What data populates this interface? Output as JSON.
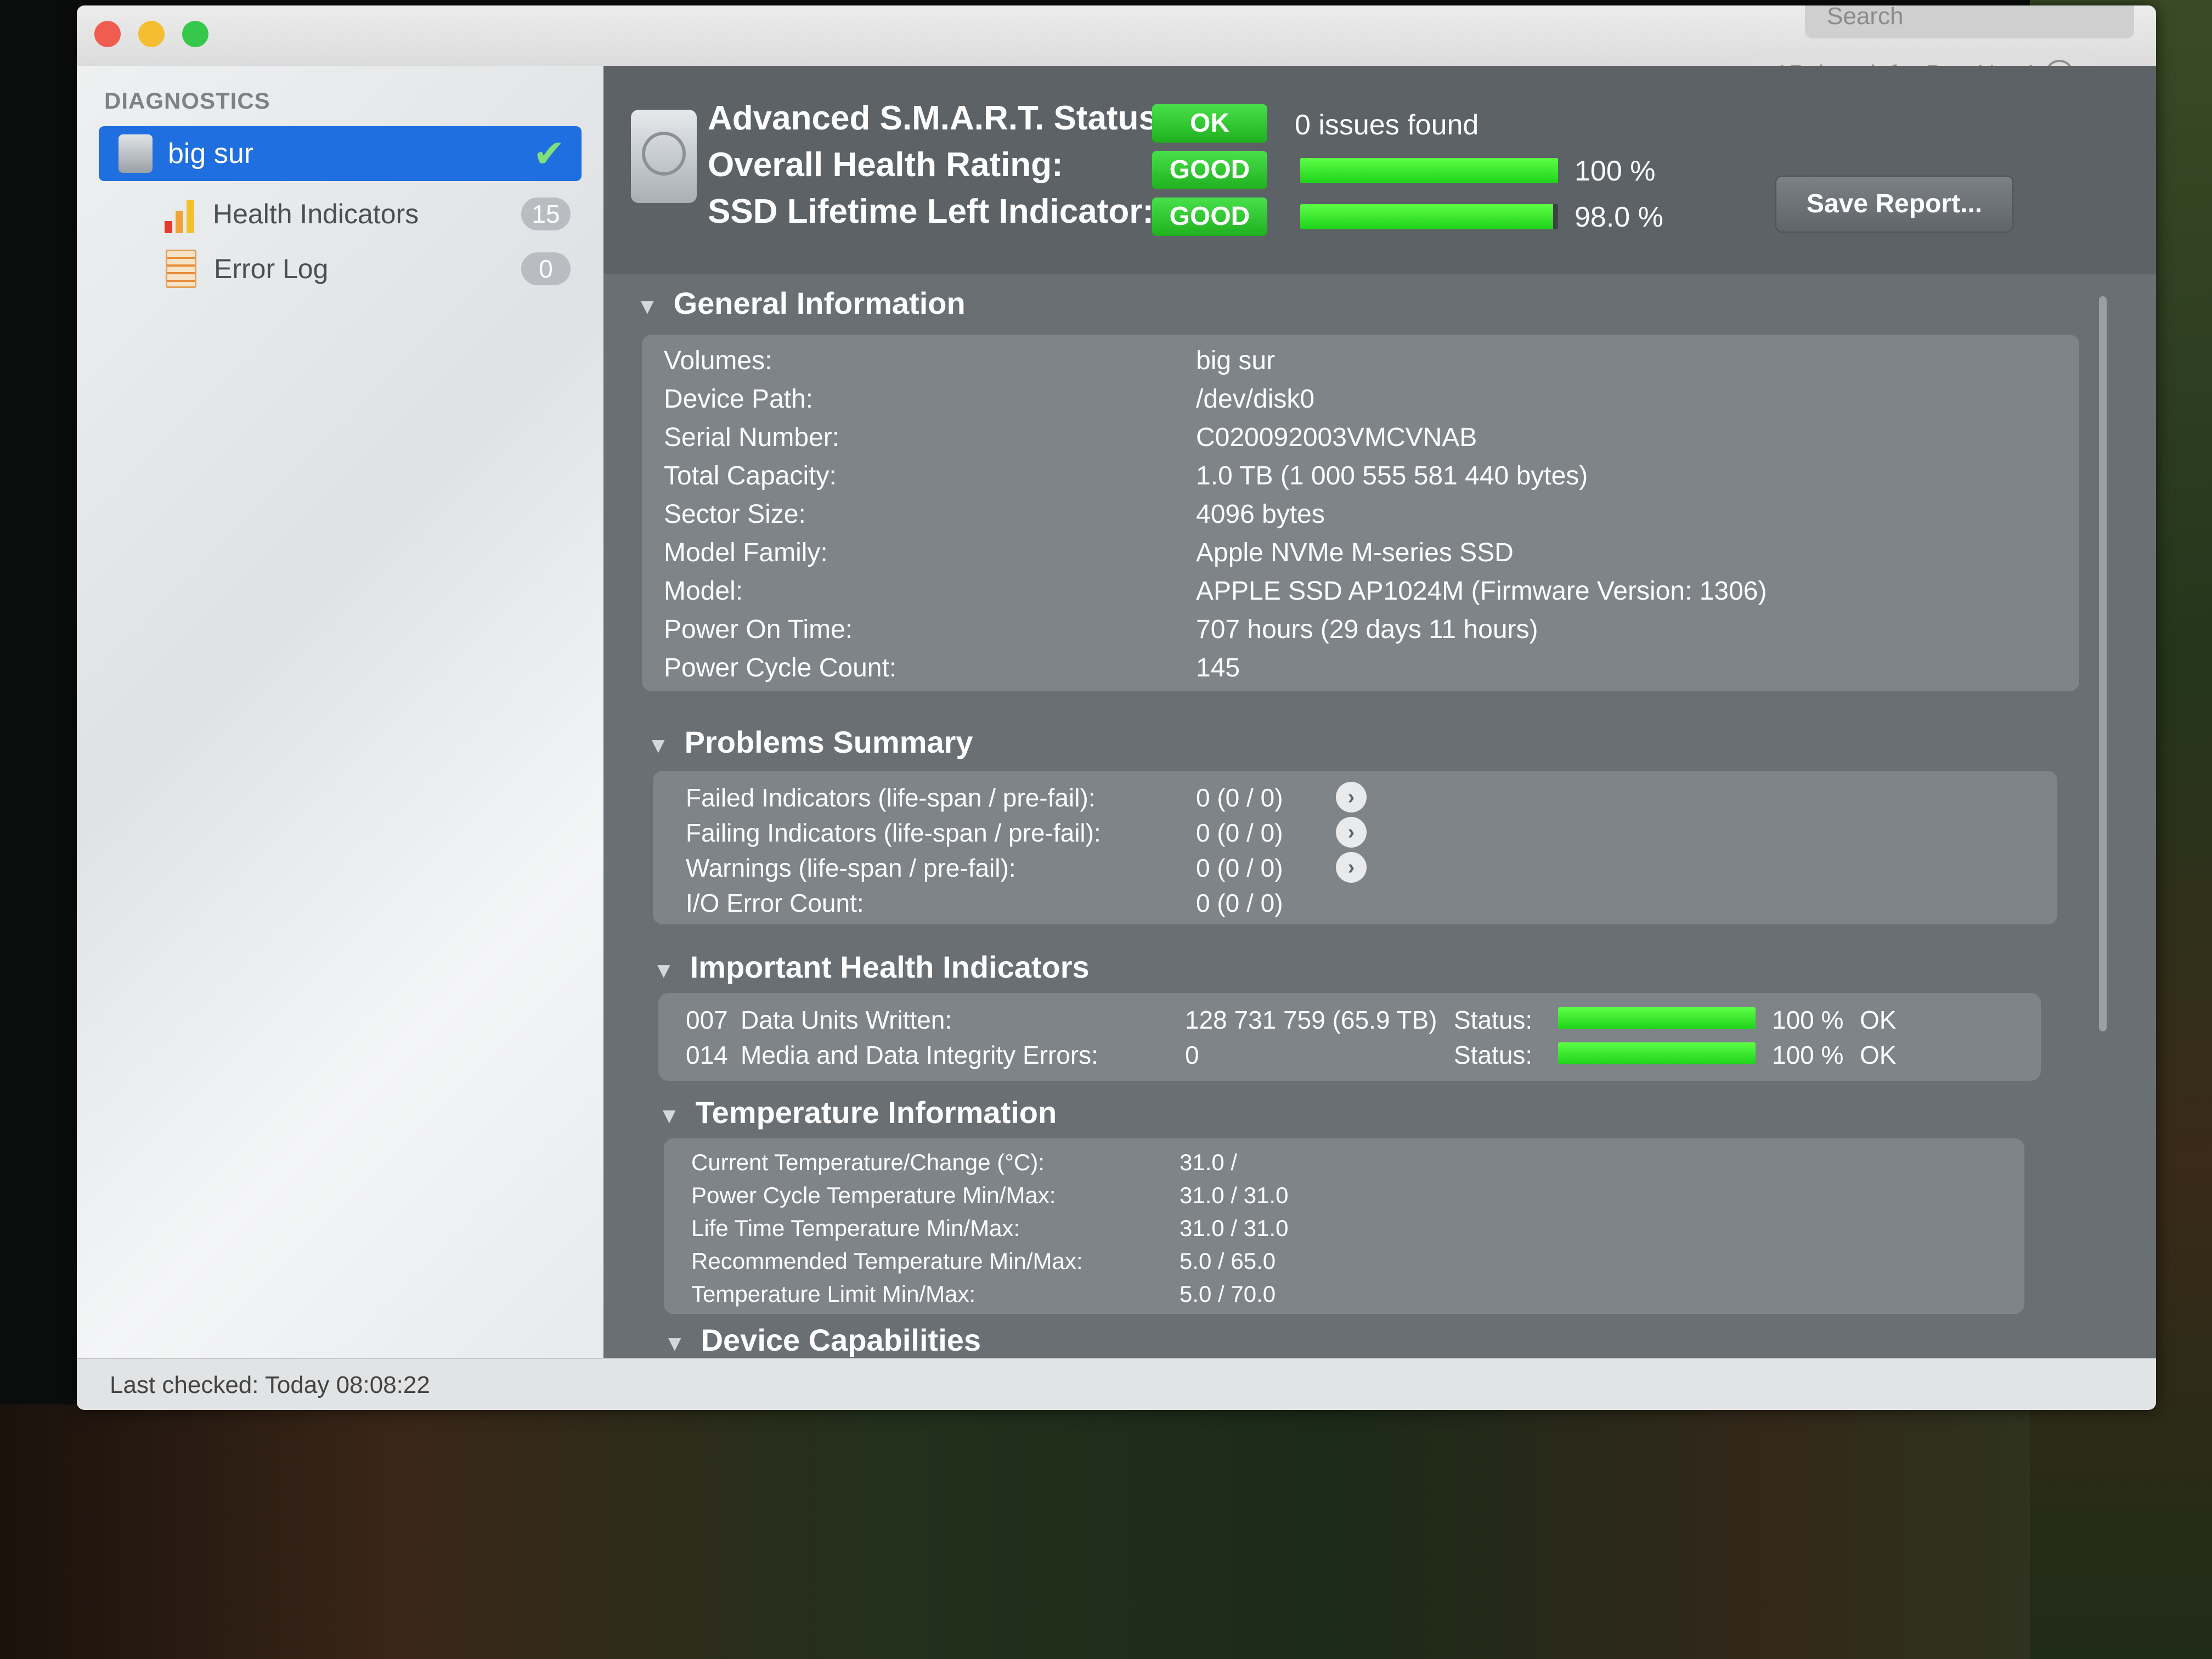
{
  "window": {
    "search_placeholder": "Search",
    "trial_text": "15 days left - Buy Now!"
  },
  "sidebar": {
    "header": "DIAGNOSTICS",
    "disk": {
      "label": "big sur"
    },
    "items": [
      {
        "label": "Health Indicators",
        "badge": "15"
      },
      {
        "label": "Error Log",
        "badge": "0"
      }
    ]
  },
  "summary": {
    "smart_label": "Advanced S.M.A.R.T. Status:",
    "smart_status": "OK",
    "smart_note": "0 issues found",
    "health_label": "Overall Health Rating:",
    "health_status": "GOOD",
    "health_percent": "100 %",
    "health_value": 1.0,
    "ssd_label": "SSD Lifetime Left Indicator:",
    "ssd_status": "GOOD",
    "ssd_percent": "98.0 %",
    "ssd_value": 0.98,
    "save_report": "Save Report..."
  },
  "general": {
    "title": "General Information",
    "rows": [
      {
        "label": "Volumes:",
        "value": "big sur"
      },
      {
        "label": "Device Path:",
        "value": "/dev/disk0"
      },
      {
        "label": "Serial Number:",
        "value": "C020092003VMCVNAB"
      },
      {
        "label": "Total Capacity:",
        "value": "1.0 TB (1 000 555 581 440 bytes)"
      },
      {
        "label": "Sector Size:",
        "value": "4096 bytes"
      },
      {
        "label": "Model Family:",
        "value": "Apple NVMe M-series SSD"
      },
      {
        "label": "Model:",
        "value": "APPLE SSD AP1024M  (Firmware Version: 1306)"
      },
      {
        "label": "Power On Time:",
        "value": "707 hours (29 days 11 hours)"
      },
      {
        "label": "Power Cycle Count:",
        "value": "145"
      }
    ]
  },
  "problems": {
    "title": "Problems Summary",
    "rows": [
      {
        "label": "Failed Indicators (life-span / pre-fail):",
        "value": "0 (0 / 0)"
      },
      {
        "label": "Failing Indicators (life-span / pre-fail):",
        "value": "0 (0 / 0)"
      },
      {
        "label": "Warnings (life-span / pre-fail):",
        "value": "0 (0 / 0)"
      },
      {
        "label": "I/O Error Count:",
        "value": "0 (0 / 0)"
      }
    ]
  },
  "indicators": {
    "title": "Important Health Indicators",
    "rows": [
      {
        "id": "007",
        "label": "Data Units Written:",
        "value": "128 731 759 (65.9 TB)",
        "status_label": "Status:",
        "percent": "100 %",
        "level": 1.0,
        "state": "OK"
      },
      {
        "id": "014",
        "label": "Media and Data Integrity Errors:",
        "value": "0",
        "status_label": "Status:",
        "percent": "100 %",
        "level": 1.0,
        "state": "OK"
      }
    ]
  },
  "temperature": {
    "title": "Temperature Information",
    "rows": [
      {
        "label": "Current Temperature/Change (°C):",
        "value": "31.0 /"
      },
      {
        "label": "Power Cycle Temperature Min/Max:",
        "value": "31.0 / 31.0"
      },
      {
        "label": "Life Time Temperature Min/Max:",
        "value": "31.0 / 31.0"
      },
      {
        "label": "Recommended Temperature Min/Max:",
        "value": "5.0   / 65.0"
      },
      {
        "label": "Temperature Limit Min/Max:",
        "value": "5.0   / 70.0"
      }
    ]
  },
  "capabilities": {
    "title": "Device Capabilities"
  },
  "status_bar": {
    "last_checked": "Last checked: Today 08:08:22"
  }
}
